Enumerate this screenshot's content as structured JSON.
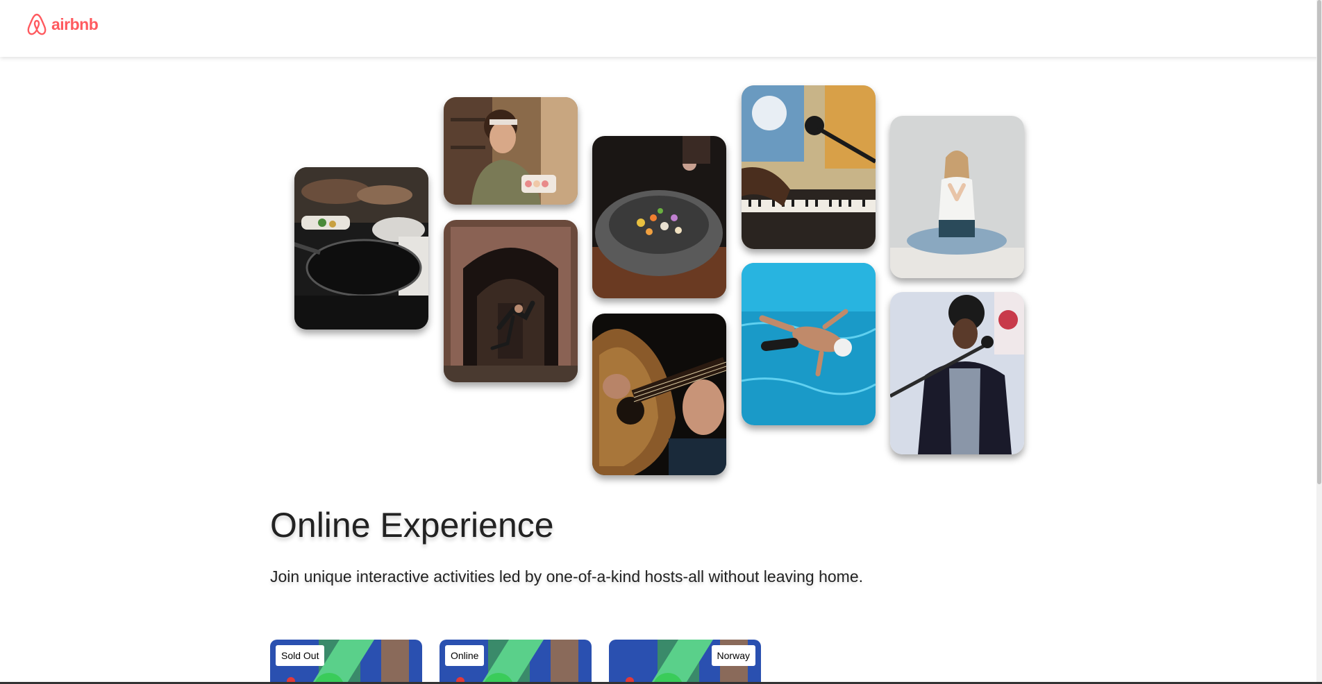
{
  "navbar": {
    "logo_text": "airbnb",
    "brand_color": "#FF5A5F",
    "logo_icon": "airbnb-belo-icon"
  },
  "hero": {
    "photos": [
      {
        "name": "photo-cooking-pan"
      },
      {
        "name": "photo-woman-macarons"
      },
      {
        "name": "photo-dancer-doorway"
      },
      {
        "name": "photo-spice-bowl"
      },
      {
        "name": "photo-guitar"
      },
      {
        "name": "photo-piano-microphone"
      },
      {
        "name": "photo-swimmer"
      },
      {
        "name": "photo-yoga"
      },
      {
        "name": "photo-singer"
      }
    ],
    "title": "Online Experience",
    "subtitle": "Join unique interactive activities led by one-of-a-kind hosts-all without leaving home."
  },
  "cards": [
    {
      "badge": "Sold Out"
    },
    {
      "badge": "Online"
    },
    {
      "badge": "Norway"
    }
  ]
}
